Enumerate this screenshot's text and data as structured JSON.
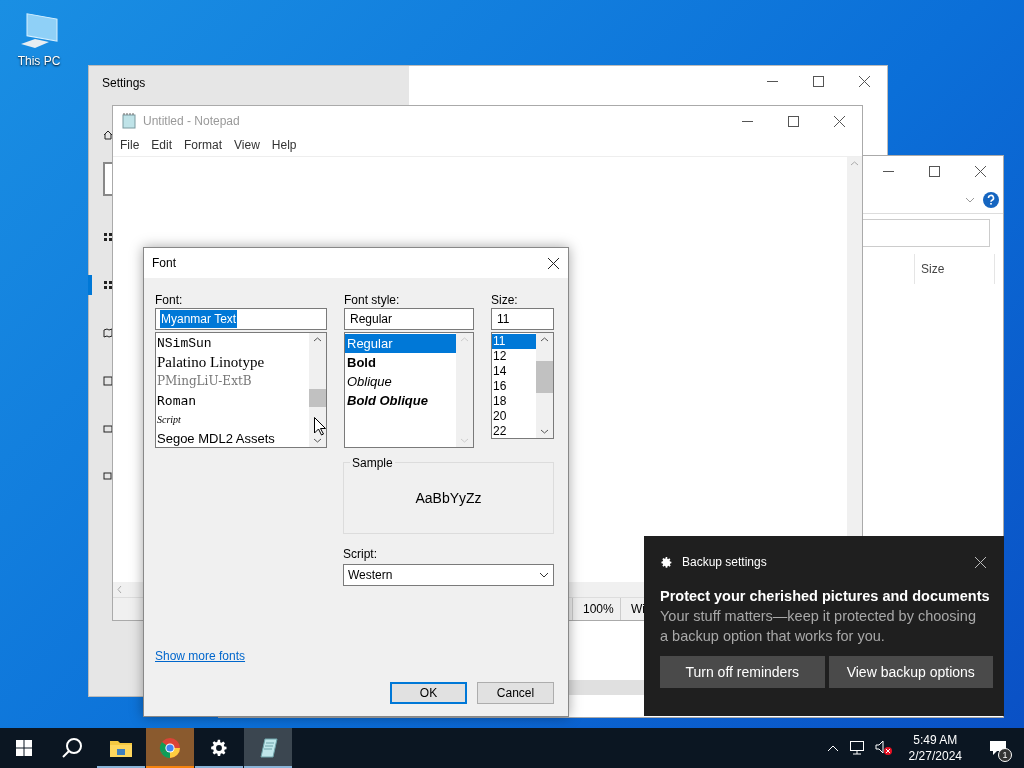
{
  "desktop": {
    "icons": [
      {
        "label": "This PC"
      }
    ]
  },
  "settings_window": {
    "title": "Settings",
    "nav": [
      {
        "selected": false
      },
      {
        "selected": true
      },
      {
        "selected": false
      },
      {
        "selected": false
      },
      {
        "selected": false
      },
      {
        "selected": false
      }
    ]
  },
  "explorer_window": {
    "column": "Size"
  },
  "notepad": {
    "title": "Untitled - Notepad",
    "menu": [
      "File",
      "Edit",
      "Format",
      "View",
      "Help"
    ],
    "status": [
      "100%",
      "Wi"
    ]
  },
  "font_dialog": {
    "title": "Font",
    "font": {
      "label": "Font:",
      "value": "Myanmar Text",
      "highlighted": true,
      "items": [
        {
          "label": "NSimSun",
          "kind": "mono",
          "selected": false
        },
        {
          "label": "Palatino Linotype",
          "kind": "serif",
          "selected": false
        },
        {
          "label": "PMingLiU-ExtB",
          "kind": "faint",
          "selected": false
        },
        {
          "label": "Roman",
          "kind": "roman",
          "selected": false
        },
        {
          "label": "Script",
          "kind": "script",
          "selected": false
        },
        {
          "label": "Segoe MDL2 Assets",
          "kind": "sans",
          "selected": false
        }
      ]
    },
    "style": {
      "label": "Font style:",
      "value": "Regular",
      "highlighted": false,
      "items": [
        {
          "label": "Regular",
          "kind": "regular",
          "selected": true
        },
        {
          "label": "Bold",
          "kind": "bold",
          "selected": false
        },
        {
          "label": "Oblique",
          "kind": "italic",
          "selected": false
        },
        {
          "label": "Bold Oblique",
          "kind": "bold-italic",
          "selected": false
        }
      ]
    },
    "size": {
      "label": "Size:",
      "value": "11",
      "highlighted": false,
      "items": [
        {
          "label": "11",
          "selected": true
        },
        {
          "label": "12",
          "selected": false
        },
        {
          "label": "14",
          "selected": false
        },
        {
          "label": "16",
          "selected": false
        },
        {
          "label": "18",
          "selected": false
        },
        {
          "label": "20",
          "selected": false
        },
        {
          "label": "22",
          "selected": false
        }
      ]
    },
    "sample": {
      "label": "Sample",
      "text": "AaBbYyZz"
    },
    "script": {
      "label": "Script:",
      "value": "Western"
    },
    "link": "Show more fonts",
    "buttons": [
      {
        "label": "OK",
        "default": true
      },
      {
        "label": "Cancel",
        "default": false
      }
    ]
  },
  "notification": {
    "source": "Backup settings",
    "title": "Protect your cherished pictures and documents",
    "body": "Your stuff matters—keep it protected by choosing a backup option that works for you.",
    "buttons": [
      "Turn off reminders",
      "View backup options"
    ]
  },
  "taskbar": {
    "apps": [
      {
        "kind": "explorer",
        "flashing": false,
        "active": false
      },
      {
        "kind": "chrome",
        "flashing": true,
        "active": false
      },
      {
        "kind": "settings",
        "flashing": false,
        "active": false
      },
      {
        "kind": "notepad",
        "flashing": false,
        "active": true
      }
    ],
    "clock": {
      "time": "5:49 AM",
      "date": "2/27/2024"
    },
    "badge": "1"
  }
}
